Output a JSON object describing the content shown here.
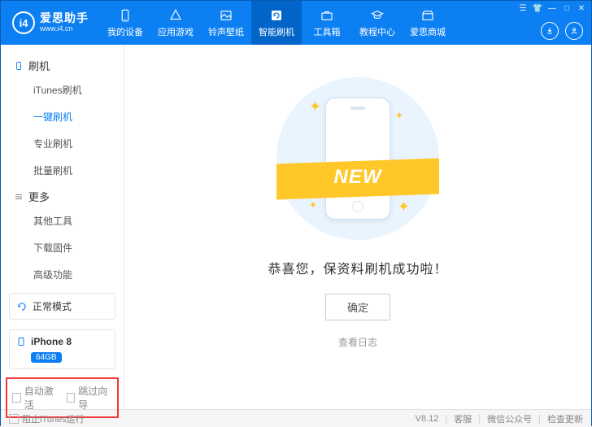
{
  "brand": {
    "name": "爱思助手",
    "url": "www.i4.cn",
    "logo_text": "i4"
  },
  "nav": {
    "items": [
      {
        "label": "我的设备"
      },
      {
        "label": "应用游戏"
      },
      {
        "label": "铃声壁纸"
      },
      {
        "label": "智能刷机"
      },
      {
        "label": "工具箱"
      },
      {
        "label": "教程中心"
      },
      {
        "label": "爱思商城"
      }
    ],
    "active_index": 3
  },
  "sidebar": {
    "groups": [
      {
        "title": "刷机",
        "items": [
          "iTunes刷机",
          "一键刷机",
          "专业刷机",
          "批量刷机"
        ],
        "active_index": 1
      },
      {
        "title": "更多",
        "items": [
          "其他工具",
          "下载固件",
          "高级功能"
        ],
        "active_index": -1
      }
    ],
    "mode": "正常模式",
    "device": {
      "name": "iPhone 8",
      "storage": "64GB"
    },
    "options": {
      "auto_activate": "自动激活",
      "skip_guide": "跳过向导"
    }
  },
  "main": {
    "ribbon": "NEW",
    "result": "恭喜您，保资料刷机成功啦！",
    "ok": "确定",
    "view_log": "查看日志"
  },
  "footer": {
    "block_itunes": "阻止iTunes运行",
    "version": "V8.12",
    "support": "客服",
    "wechat": "微信公众号",
    "update": "检查更新"
  }
}
